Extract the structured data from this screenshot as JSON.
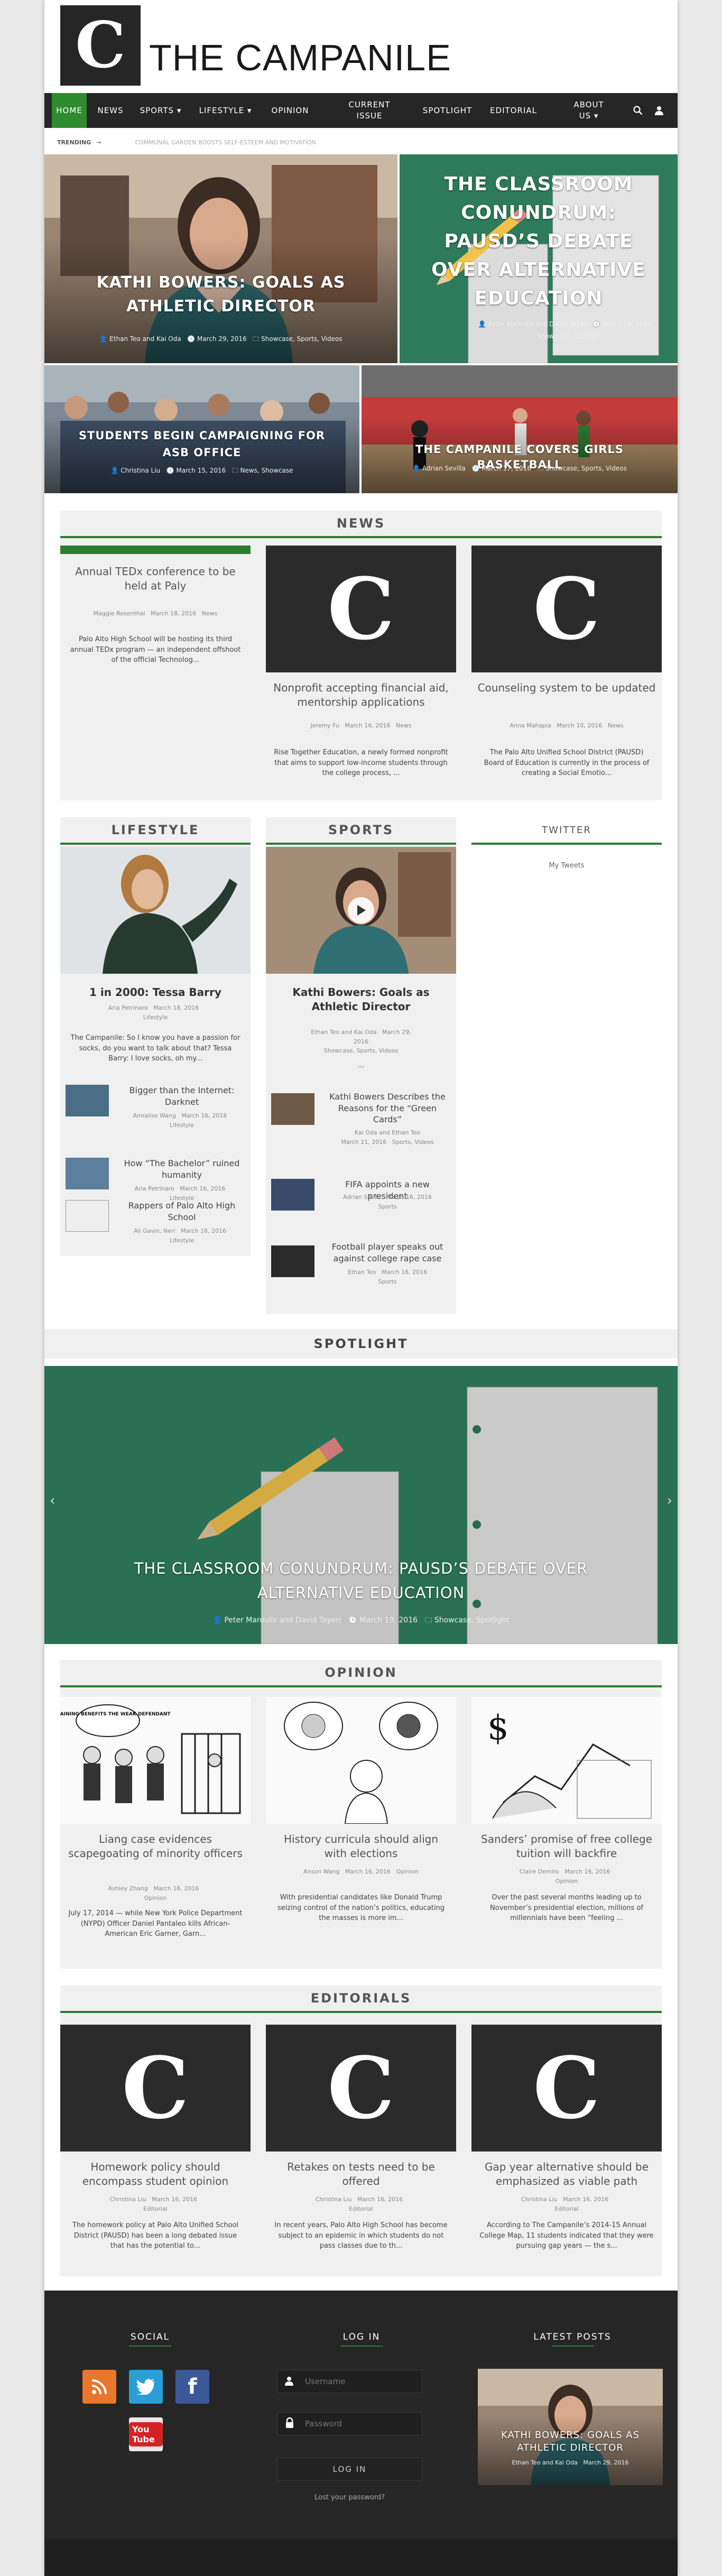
{
  "site": {
    "logo_letter": "C",
    "name": "THE CAMPANILE",
    "accent": "#2e7d32",
    "nav_bg": "#262626"
  },
  "nav": {
    "items": [
      {
        "label": "HOME"
      },
      {
        "label": "NEWS"
      },
      {
        "label": "SPORTS ▾"
      },
      {
        "label": "LIFESTYLE ▾"
      },
      {
        "label": "OPINION"
      },
      {
        "label": "CURRENT ISSUE"
      },
      {
        "label": "SPOTLIGHT"
      },
      {
        "label": "EDITORIAL"
      },
      {
        "label": "ABOUT US ▾"
      }
    ],
    "search_icon": "search-icon",
    "user_icon": "user-icon"
  },
  "trending": {
    "label": "TRENDING",
    "arrow": "→",
    "text": "COMMUNAL GARDEN BOOSTS SELF-ESTEEM AND MOTIVATION"
  },
  "hero": {
    "main": {
      "title": "KATHI BOWERS: GOALS AS ATHLETIC DIRECTOR",
      "author": "Ethan Teo and Kai Oda",
      "date": "March 29, 2016",
      "cats": "Showcase, Sports, Videos"
    },
    "right": {
      "title": "THE CLASSROOM CONUNDRUM: PAUSD’S DEBATE OVER ALTERNATIVE EDUCATION",
      "author": "Peter Maroulis and David Tayeri",
      "date": "March 19, 2016",
      "cats": "Showcase, Spotlight"
    },
    "left_small": {
      "title": "STUDENTS BEGIN CAMPAIGNING FOR ASB OFFICE",
      "author": "Christina Liu",
      "date": "March 15, 2016",
      "cats": "News, Showcase"
    },
    "right_small": {
      "title": "THE CAMPANILE COVERS GIRLS BASKETBALL",
      "author": "Adrian Sevilla",
      "date": "March 17, 2016",
      "cats": "Showcase, Sports, Videos"
    }
  },
  "news": {
    "heading": "NEWS",
    "cards": [
      {
        "title": "Annual TEDx conference to be held at Paly",
        "author": "Maggie Rosenthal",
        "date": "March 18, 2016",
        "cat": "News",
        "excerpt": "Palo Alto High School will be hosting its third annual TEDx program — an independent offshoot of the official Technolog..."
      },
      {
        "title": "Nonprofit accepting financial aid, mentorship applications",
        "author": "Jeremy Fu",
        "date": "March 16, 2016",
        "cat": "News",
        "excerpt": "Rise Together Education, a newly formed nonprofit that aims to support low-income students through the college process, ..."
      },
      {
        "title": "Counseling system to be updated",
        "author": "Anna Mahapia",
        "date": "March 10, 2016",
        "cat": "News",
        "excerpt": "The Palo Alto Unified School District (PAUSD) Board of Education is currently in the process of creating a Social Emotio..."
      }
    ]
  },
  "lifestyle": {
    "heading": "LIFESTYLE",
    "main": {
      "title": "1 in 2000: Tessa Barry",
      "author": "Aria Petrinaro",
      "date": "March 18, 2016",
      "cat": "Lifestyle",
      "excerpt": "The Campanile: So I know you have a passion for socks, do you want to talk about that? Tessa Barry: I love socks, oh my..."
    },
    "items": [
      {
        "title": "Bigger than the Internet: Darknet",
        "author": "Annalise Wang",
        "date": "March 16, 2016",
        "cat": "Lifestyle"
      },
      {
        "title": "How “The Bachelor” ruined humanity",
        "author": "Aria Petrinaro",
        "date": "March 16, 2016",
        "cat": "Lifestyle"
      },
      {
        "title": "Rappers of Palo Alto High School",
        "author": "Ali Gavin, Neri",
        "date": "March 16, 2016",
        "cat": "Lifestyle"
      }
    ]
  },
  "sports": {
    "heading": "SPORTS",
    "main": {
      "title": "Kathi Bowers: Goals as Athletic Director",
      "author": "Ethan Teo and Kai Oda",
      "date": "March 29, 2016",
      "cat": "Showcase, Sports, Videos",
      "excerpt": "..."
    },
    "items": [
      {
        "title": "Kathi Bowers Describes the Reasons for the “Green Cards”",
        "author": "Kai Oda and Ethan Teo",
        "date": "March 21, 2016",
        "cat": "Sports, Videos"
      },
      {
        "title": "FIFA appoints a new president",
        "author": "Adrian Smith",
        "date": "March 16, 2016",
        "cat": "Sports"
      },
      {
        "title": "Football player speaks out against college rape case",
        "author": "Ethan Teo",
        "date": "March 16, 2016",
        "cat": "Sports"
      }
    ]
  },
  "twitter": {
    "heading": "TWITTER",
    "link": "My Tweets"
  },
  "spotlight": {
    "heading": "SPOTLIGHT",
    "title": "THE CLASSROOM CONUNDRUM: PAUSD’S DEBATE OVER ALTERNATIVE EDUCATION",
    "author": "Peter Maroulis and David Tayeri",
    "date": "March 19, 2016",
    "cats": "Showcase, Spotlight",
    "prev": "‹",
    "next": "›"
  },
  "opinion": {
    "heading": "OPINION",
    "cards": [
      {
        "title": "Liang case evidences scapegoating of minority officers",
        "author": "Ashley Zhang",
        "date": "March 16, 2016",
        "cat": "Opinion",
        "excerpt": "July 17, 2014 — while New York Police Department (NYPD) Officer Daniel Pantaleo kills African-American Eric Garner, Garn...",
        "art_text": "BARGAINING BENEFITS THE WEAK DEFENDANT"
      },
      {
        "title": "History curricula should align with elections",
        "author": "Anson Wang",
        "date": "March 16, 2016",
        "cat": "Opinion",
        "excerpt": "With presidential candidates like Donald Trump seizing control of the nation’s politics, educating the masses is more im..."
      },
      {
        "title": "Sanders’ promise of free college tuition will backfire",
        "author": "Claire Demiro",
        "date": "March 16, 2016",
        "cat": "Opinion",
        "excerpt": "Over the past several months leading up to November’s presidential election, millions of millennials have been “feeling ..."
      }
    ]
  },
  "editorials": {
    "heading": "EDITORIALS",
    "cards": [
      {
        "title": "Homework policy should encompass student opinion",
        "author": "Christina Liu",
        "date": "March 16, 2016",
        "cat": "Editorial",
        "excerpt": "The homework policy at Palo Alto Unified School District (PAUSD) has been a long debated issue that has the potential to..."
      },
      {
        "title": "Retakes on tests need to be offered",
        "author": "Christina Liu",
        "date": "March 16, 2016",
        "cat": "Editorial",
        "excerpt": "In recent years, Palo Alto High School has become subject to an epidemic in which students do not pass classes due to th..."
      },
      {
        "title": "Gap year alternative should be emphasized as viable path",
        "author": "Christina Liu",
        "date": "March 16, 2016",
        "cat": "Editorial",
        "excerpt": "According to The Campanile’s 2014-15 Annual College Map, 11 students indicated that they were pursuing gap years — the s..."
      }
    ]
  },
  "footer": {
    "social_heading": "SOCIAL",
    "login_heading": "LOG IN",
    "latest_heading": "LATEST POSTS",
    "youtube": "You Tube",
    "username_placeholder": "Username",
    "password_placeholder": "Password",
    "login_button": "LOG IN",
    "lost_password": "Lost your password?",
    "latest": {
      "title": "KATHI BOWERS: GOALS AS ATHLETIC DIRECTOR",
      "author": "Ethan Teo and Kai Oda",
      "date": "March 29, 2016"
    }
  }
}
